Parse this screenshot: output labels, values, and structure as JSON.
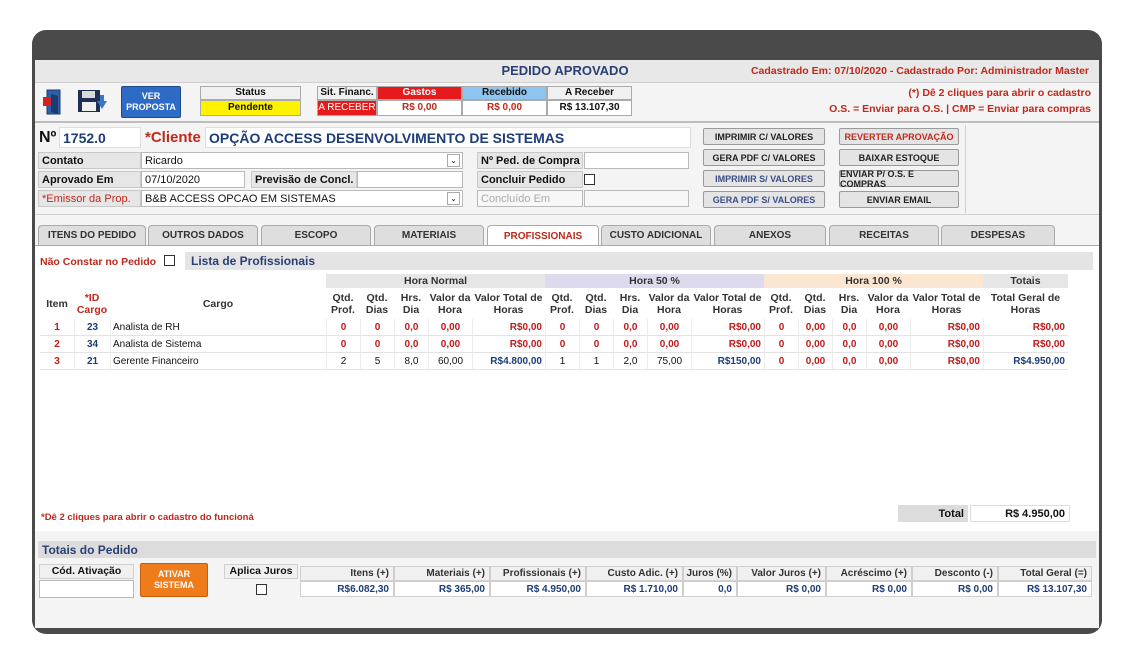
{
  "header": {
    "title": "PEDIDO APROVADO",
    "registered": "Cadastrado Em: 07/10/2020 - Cadastrado Por: Administrador Master",
    "hint1": "(*) Dê 2 cliques para abrir o cadastro",
    "hint2": "O.S. = Enviar para O.S. | CMP = Enviar para compras"
  },
  "toolbar": {
    "ver_proposta": "VER PROPOSTA",
    "status_label": "Status",
    "status_value": "Pendente",
    "sit_financ_label": "Sit. Financ.",
    "sit_financ_value": "A RECEBER",
    "gastos_label": "Gastos",
    "gastos_value": "R$ 0,00",
    "recebido_label": "Recebido",
    "recebido_value": "R$ 0,00",
    "a_receber_label": "A Receber",
    "a_receber_value": "R$ 13.107,30"
  },
  "order": {
    "number_label": "Nº",
    "number": "1752.0",
    "cliente_label": "*Cliente",
    "cliente": "OPÇÃO ACCESS DESENVOLVIMENTO DE SISTEMAS",
    "contato_label": "Contato",
    "contato": "Ricardo",
    "aprovado_em_label": "Aprovado Em",
    "aprovado_em": "07/10/2020",
    "previsao_label": "Previsão de Concl.",
    "previsao": "",
    "emissor_label": "*Emissor da Prop.",
    "emissor": "B&B  ACCESS OPCAO EM SISTEMAS",
    "ped_compra_label": "Nº Ped. de Compra",
    "concluir_label": "Concluir Pedido",
    "concluido_placeholder": "Concluído Em"
  },
  "actions": {
    "imprimir_cv": "IMPRIMIR C/ VALORES",
    "gera_pdf_cv": "GERA PDF C/ VALORES",
    "imprimir_sv": "IMPRIMIR S/ VALORES",
    "gera_pdf_sv": "GERA PDF S/ VALORES",
    "reverter": "REVERTER APROVAÇÃO",
    "baixar": "BAIXAR ESTOQUE",
    "enviar_os": "ENVIAR P/ O.S. E COMPRAS",
    "enviar_email": "ENVIAR EMAIL"
  },
  "tabs": [
    "ITENS DO PEDIDO",
    "OUTROS DADOS",
    "ESCOPO",
    "MATERIAIS",
    "PROFISSIONAIS",
    "CUSTO ADICIONAL",
    "ANEXOS",
    "RECEITAS",
    "DESPESAS"
  ],
  "profissionais": {
    "nao_constar": "Não Constar no Pedido",
    "lista_title": "Lista de Profissionais",
    "groups": {
      "normal": "Hora Normal",
      "h50": "Hora 50 %",
      "h100": "Hora 100 %",
      "totais": "Totais"
    },
    "columns": {
      "item": "Item",
      "id_cargo": "*ID Cargo",
      "cargo": "Cargo",
      "qtd_prof": "Qtd. Prof.",
      "qtd_dias": "Qtd. Dias",
      "hrs_dia": "Hrs. Dia",
      "valor_hora": "Valor da Hora",
      "valor_total": "Valor Total de Horas",
      "total_geral": "Total Geral de Horas"
    },
    "rows": [
      {
        "item": "1",
        "id": "23",
        "cargo": "Analista de RH",
        "n": [
          "0",
          "0",
          "0,0",
          "0,00",
          "R$0,00"
        ],
        "h50": [
          "0",
          "0",
          "0,0",
          "0,00",
          "R$0,00"
        ],
        "h100": [
          "0",
          "0,00",
          "0,0",
          "0,00",
          "R$0,00"
        ],
        "total": "R$0,00",
        "style": "red"
      },
      {
        "item": "2",
        "id": "34",
        "cargo": "Analista de Sistema",
        "n": [
          "0",
          "0",
          "0,0",
          "0,00",
          "R$0,00"
        ],
        "h50": [
          "0",
          "0",
          "0,0",
          "0,00",
          "R$0,00"
        ],
        "h100": [
          "0",
          "0,00",
          "0,0",
          "0,00",
          "R$0,00"
        ],
        "total": "R$0,00",
        "style": "red"
      },
      {
        "item": "3",
        "id": "21",
        "cargo": "Gerente Financeiro",
        "n": [
          "2",
          "5",
          "8,0",
          "60,00",
          "R$4.800,00"
        ],
        "h50": [
          "1",
          "1",
          "2,0",
          "75,00",
          "R$150,00"
        ],
        "h100": [
          "0",
          "0,00",
          "0,0",
          "0,00",
          "R$0,00"
        ],
        "total": "R$4.950,00",
        "style": "mixed"
      }
    ],
    "footer_hint": "*Dê 2 cliques para abrir o cadastro do funcioná",
    "total_label": "Total",
    "total_value": "R$ 4.950,00"
  },
  "totais": {
    "title": "Totais do Pedido",
    "cod_ativacao": "Cód. Ativação",
    "ativar": "ATIVAR SISTEMA",
    "aplica_juros": "Aplica Juros",
    "cols": [
      {
        "label": "Itens (+)",
        "value": "R$6.082,30"
      },
      {
        "label": "Materiais (+)",
        "value": "R$ 365,00"
      },
      {
        "label": "Profissionais (+)",
        "value": "R$ 4.950,00"
      },
      {
        "label": "Custo Adic. (+)",
        "value": "R$ 1.710,00"
      },
      {
        "label": "Juros (%)",
        "value": "0,0"
      },
      {
        "label": "Valor Juros (+)",
        "value": "R$ 0,00"
      },
      {
        "label": "Acréscimo (+)",
        "value": "R$ 0,00"
      },
      {
        "label": "Desconto (-)",
        "value": "R$ 0,00"
      },
      {
        "label": "Total Geral (=)",
        "value": "R$ 13.107,30"
      }
    ]
  },
  "icons": [
    "exit-door-icon",
    "save-disk-icon",
    "checkbox-icon",
    "chevron-down-icon"
  ],
  "colors": {
    "accent_red": "#c0281b",
    "dark_blue": "#1d3c78",
    "orange": "#ef7b1a",
    "yellow": "#fff200"
  }
}
